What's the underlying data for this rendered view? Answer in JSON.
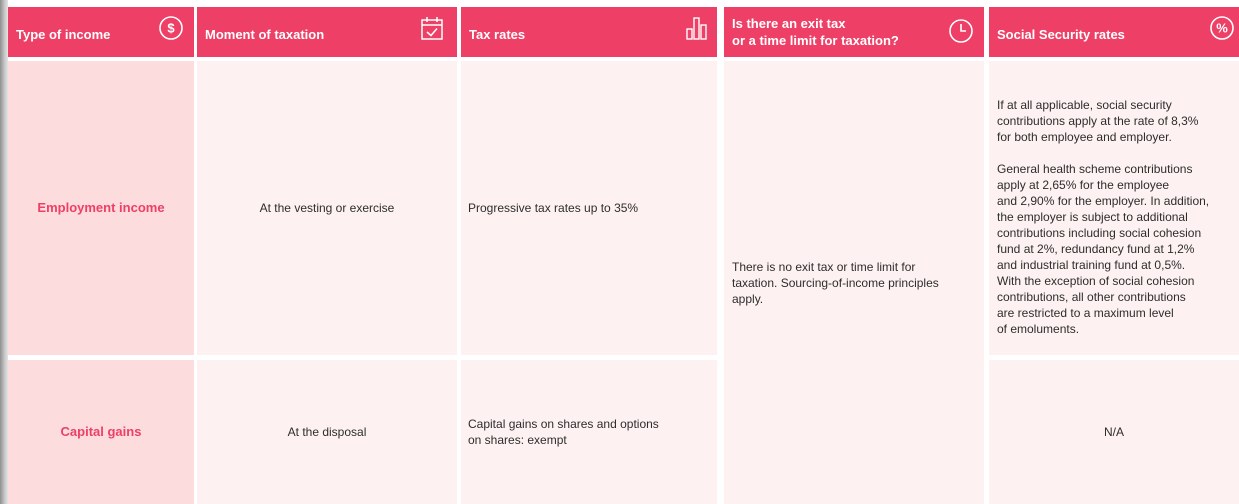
{
  "colors": {
    "header": "#ee3f66",
    "cell": "#fdf1f1",
    "label_cell": "#fcdcdc",
    "label_text": "#ee3f66"
  },
  "headers": [
    {
      "label": "Type of income",
      "icon": "dollar-circle-icon"
    },
    {
      "label": "Moment of taxation",
      "icon": "calendar-check-icon"
    },
    {
      "label": "Tax rates",
      "icon": "bar-chart-icon"
    },
    {
      "label": "Is there an exit tax",
      "label2": "or a time limit for taxation?",
      "icon": "clock-icon"
    },
    {
      "label": "Social Security rates",
      "icon": "percent-circle-icon"
    }
  ],
  "rows": [
    {
      "type": "Employment income",
      "moment": "At the vesting or exercise",
      "rates": "Progressive tax rates up to 35%",
      "social_lines_p1": [
        "If at all applicable, social security",
        "contributions apply at the rate of 8,3%",
        "for both employee and employer."
      ],
      "social_lines_p2": [
        "General health scheme contributions",
        "apply at 2,65% for the employee",
        "and 2,90% for the employer. In addition,",
        "the employer is subject to additional",
        "contributions including social cohesion",
        "fund at 2%, redundancy fund at 1,2%",
        "and industrial training fund at 0,5%.",
        "With the exception of social cohesion",
        "contributions, all other contributions",
        "are restricted to a maximum level",
        "of emoluments."
      ]
    },
    {
      "type": "Capital gains",
      "moment": "At the disposal",
      "rates_lines": [
        "Capital gains on shares and options",
        "on shares: exempt"
      ],
      "social": "N/A"
    }
  ],
  "exit_tax_lines": [
    "There is no exit tax or time limit for",
    "taxation. Sourcing-of-income principles",
    "apply."
  ]
}
